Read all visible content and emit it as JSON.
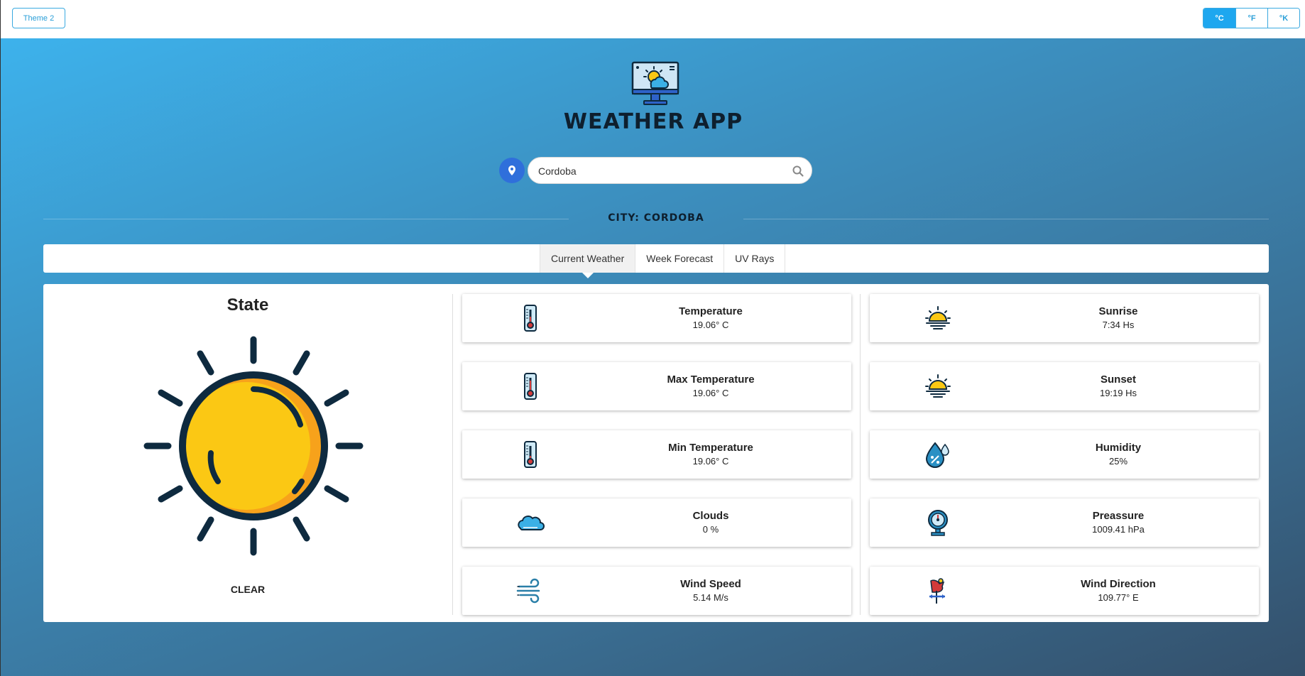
{
  "header": {
    "theme_button": "Theme 2",
    "units": [
      "°C",
      "°F",
      "°K"
    ],
    "active_unit": "°C"
  },
  "app": {
    "title": "WEATHER APP"
  },
  "search": {
    "value": "Cordoba"
  },
  "city": {
    "label": "CITY: CORDOBA"
  },
  "tabs": [
    "Current Weather",
    "Week Forecast",
    "UV Rays"
  ],
  "state": {
    "title": "State",
    "description": "CLEAR",
    "icon": "sun-icon"
  },
  "metrics_left": [
    {
      "label": "Temperature",
      "value": "19.06° C",
      "icon": "thermometer-icon"
    },
    {
      "label": "Max Temperature",
      "value": "19.06° C",
      "icon": "thermometer-icon"
    },
    {
      "label": "Min Temperature",
      "value": "19.06° C",
      "icon": "thermometer-icon"
    },
    {
      "label": "Clouds",
      "value": "0 %",
      "icon": "cloud-icon"
    },
    {
      "label": "Wind Speed",
      "value": "5.14 M/s",
      "icon": "wind-icon"
    }
  ],
  "metrics_right": [
    {
      "label": "Sunrise",
      "value": "7:34 Hs",
      "icon": "sunrise-icon"
    },
    {
      "label": "Sunset",
      "value": "19:19 Hs",
      "icon": "sunset-icon"
    },
    {
      "label": "Humidity",
      "value": "25%",
      "icon": "humidity-drop-icon"
    },
    {
      "label": "Preassure",
      "value": "1009.41 hPa",
      "icon": "barometer-icon"
    },
    {
      "label": "Wind Direction",
      "value": "109.77° E",
      "icon": "weathervane-icon"
    }
  ],
  "colors": {
    "accent": "#1ea7ef",
    "gradient_start": "#3db2ec",
    "gradient_end": "#34506b",
    "location_button": "#2f6fdb",
    "sun_yellow": "#fbc814",
    "sun_orange": "#f7a21b",
    "outline": "#0e2a3f"
  }
}
